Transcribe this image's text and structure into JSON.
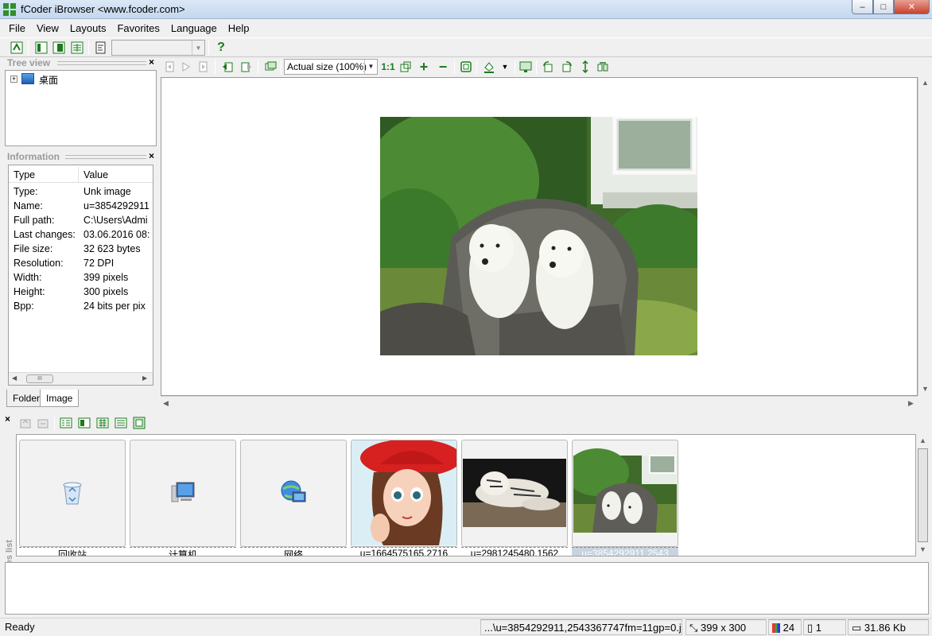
{
  "window": {
    "title": "fCoder iBrowser <www.fcoder.com>",
    "min": "‒",
    "max": "□",
    "close": "✕"
  },
  "menu": [
    "File",
    "View",
    "Layouts",
    "Favorites",
    "Language",
    "Help"
  ],
  "toolbar_icons": [
    "refresh-icon",
    "layout-left-icon",
    "layout-middle-icon",
    "layout-grid-icon",
    "properties-icon",
    "help-icon"
  ],
  "help_label": "?",
  "tree": {
    "panel_title": "Tree view",
    "close": "×",
    "expander": "+",
    "root_label": "桌面"
  },
  "info": {
    "panel_title": "Information",
    "close": "×",
    "col_type": "Type",
    "col_value": "Value",
    "rows": [
      {
        "k": "Type:",
        "v": "Unk image"
      },
      {
        "k": "Name:",
        "v": "u=3854292911"
      },
      {
        "k": "Full path:",
        "v": "C:\\Users\\Admi"
      },
      {
        "k": "Last changes:",
        "v": "03.06.2016 08:"
      },
      {
        "k": "File size:",
        "v": "32 623  bytes"
      },
      {
        "k": "Resolution:",
        "v": "72 DPI"
      },
      {
        "k": "Width:",
        "v": "399 pixels"
      },
      {
        "k": "Height:",
        "v": "300 pixels"
      },
      {
        "k": "Bpp:",
        "v": "24 bits per pix"
      }
    ],
    "scroll_left": "◀",
    "scroll_right": "▶",
    "thumb_grip": "III"
  },
  "left_tabs": {
    "folder": "Folder",
    "image": "Image"
  },
  "viewer": {
    "zoom_value": "Actual size (100%)",
    "zoom_arrow": "▼",
    "one_to_one": "1:1",
    "plus": "+",
    "minus": "−",
    "color_arrow": "▼"
  },
  "images_list": {
    "label": "Images list",
    "close": "×",
    "items": [
      {
        "caption": "回收站",
        "kind": "recycle-bin-icon"
      },
      {
        "caption": "计算机",
        "kind": "computer-icon"
      },
      {
        "caption": "网络",
        "kind": "network-icon"
      },
      {
        "caption": "u=1664575165,2716",
        "kind": "girl-thumbnail"
      },
      {
        "caption": "u=2981245480,1562",
        "kind": "tiger-thumbnail"
      },
      {
        "caption": "u=3854292911,2543",
        "kind": "puppies-thumbnail"
      }
    ]
  },
  "status": {
    "ready": "Ready",
    "path": "...\\u=3854292911,2543367747fm=11gp=0.jp",
    "dimensions": "399 x 300",
    "bpp": "24",
    "index": "1",
    "size": "31.86 Kb"
  },
  "colors": {
    "title_gradient_top": "#dbe8f6",
    "close_red": "#c8422d",
    "selected_caption": "#c8d3e0"
  }
}
